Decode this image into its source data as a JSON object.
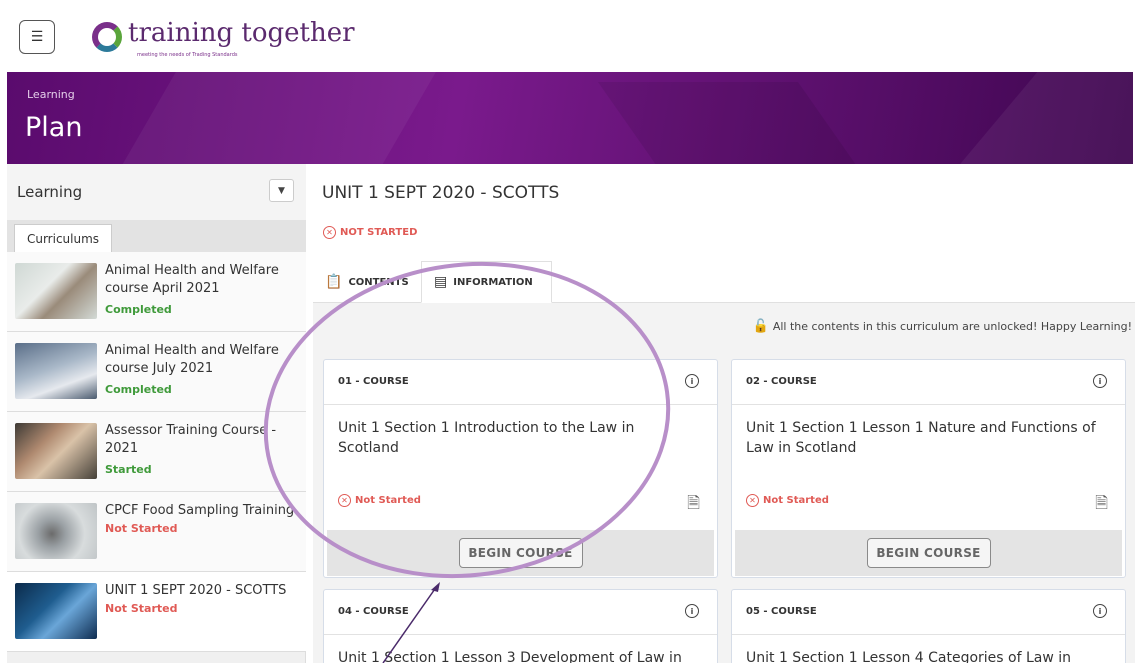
{
  "header": {
    "menu_icon": "hamburger-icon",
    "logo_text": "training together",
    "logo_tagline": "meeting the needs of Trading Standards"
  },
  "banner": {
    "subtitle": "Learning",
    "title": "Plan",
    "background_color": "#6a1280"
  },
  "sidebar": {
    "title": "Learning",
    "dropdown_icon": "caret-down-icon",
    "tab": "Curriculums",
    "items": [
      {
        "name": "Animal Health and Welfare course April 2021",
        "status": "Completed",
        "status_color": "#3f9a3a"
      },
      {
        "name": "Animal Health and Welfare course July 2021",
        "status": "Completed",
        "status_color": "#3f9a3a"
      },
      {
        "name": "Assessor Training Course - 2021",
        "status": "Started",
        "status_color": "#3f9a3a"
      },
      {
        "name": "CPCF Food Sampling Training",
        "status": "Not Started",
        "status_color": "#e05a55"
      },
      {
        "name": "UNIT 1 SEPT 2020 - SCOTTS",
        "status": "Not Started",
        "status_color": "#e05a55"
      }
    ]
  },
  "main": {
    "title": "UNIT 1 SEPT 2020 - SCOTTS",
    "status": "NOT STARTED",
    "tabs": [
      {
        "label": "CONTENTS",
        "icon": "clipboard-icon"
      },
      {
        "label": "INFORMATION",
        "icon": "document-list-icon"
      }
    ],
    "unlock_message": "All the contents in this curriculum are unlocked! Happy Learning!",
    "cards": [
      {
        "label": "01 - COURSE",
        "title": "Unit 1 Section 1 Introduction to the Law in Scotland",
        "status": "Not Started",
        "button": "BEGIN COURSE"
      },
      {
        "label": "02 - COURSE",
        "title": "Unit 1 Section 1 Lesson 1 Nature and Functions of Law in Scotland",
        "status": "Not Started",
        "button": "BEGIN COURSE"
      },
      {
        "label": "04 - COURSE",
        "title": "Unit 1 Section 1 Lesson 3 Development of Law in",
        "status": "",
        "button": ""
      },
      {
        "label": "05 - COURSE",
        "title": "Unit 1 Section 1 Lesson 4 Categories of Law in",
        "status": "",
        "button": ""
      }
    ]
  },
  "annotation_color": "#b88fc9"
}
